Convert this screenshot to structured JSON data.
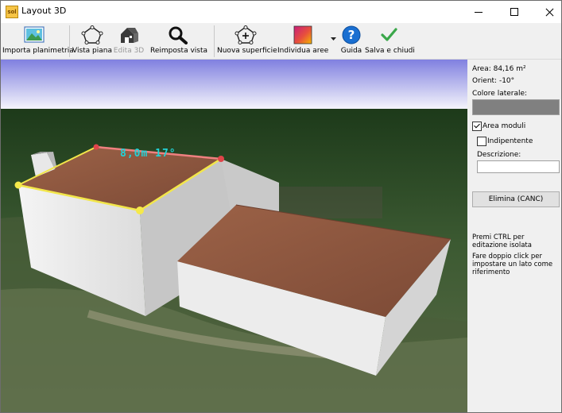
{
  "window": {
    "title": "Layout 3D",
    "app_icon_text": "sol"
  },
  "toolbar": {
    "items": [
      {
        "label": "Importa planimetria",
        "icon": "import-floorplan-icon",
        "enabled": true
      },
      {
        "label": "Vista piana",
        "icon": "plan-view-icon",
        "enabled": true
      },
      {
        "label": "Edita 3D",
        "icon": "house-3d-icon",
        "enabled": false
      },
      {
        "label": "Reimposta vista",
        "icon": "reset-view-magnifier-icon",
        "enabled": true
      },
      {
        "label": "Nuova superficie",
        "icon": "new-surface-icon",
        "enabled": true
      },
      {
        "label": "Individua aree",
        "icon": "detect-areas-icon",
        "enabled": true
      },
      {
        "label": "Guida",
        "icon": "help-icon",
        "enabled": true
      },
      {
        "label": "Salva e chiudi",
        "icon": "checkmark-icon",
        "enabled": true
      }
    ]
  },
  "viewport": {
    "dimension_label": "8,0m   17°"
  },
  "panel": {
    "area": "Area: 84,16 m²",
    "orient": "Orient: -10°",
    "side_color_label": "Colore laterale:",
    "side_color": "#808080",
    "area_moduli_label": "Area moduli",
    "area_moduli_checked": true,
    "independent_label": "Indipentente",
    "independent_checked": false,
    "description_label": "Descrizione:",
    "description_value": "",
    "delete_button": "Elimina (CANC)",
    "hint_ctrl": "Premi CTRL per editazione isolata",
    "hint_double_click": "Fare doppio click per impostare un lato come riferimento"
  },
  "colors": {
    "accent_help": "#1a6fd1",
    "check_green": "#3aa74a",
    "edge_selected": "#f2e64a",
    "edge_highlight": "#f08080",
    "dimension_text": "#22d3d8"
  }
}
